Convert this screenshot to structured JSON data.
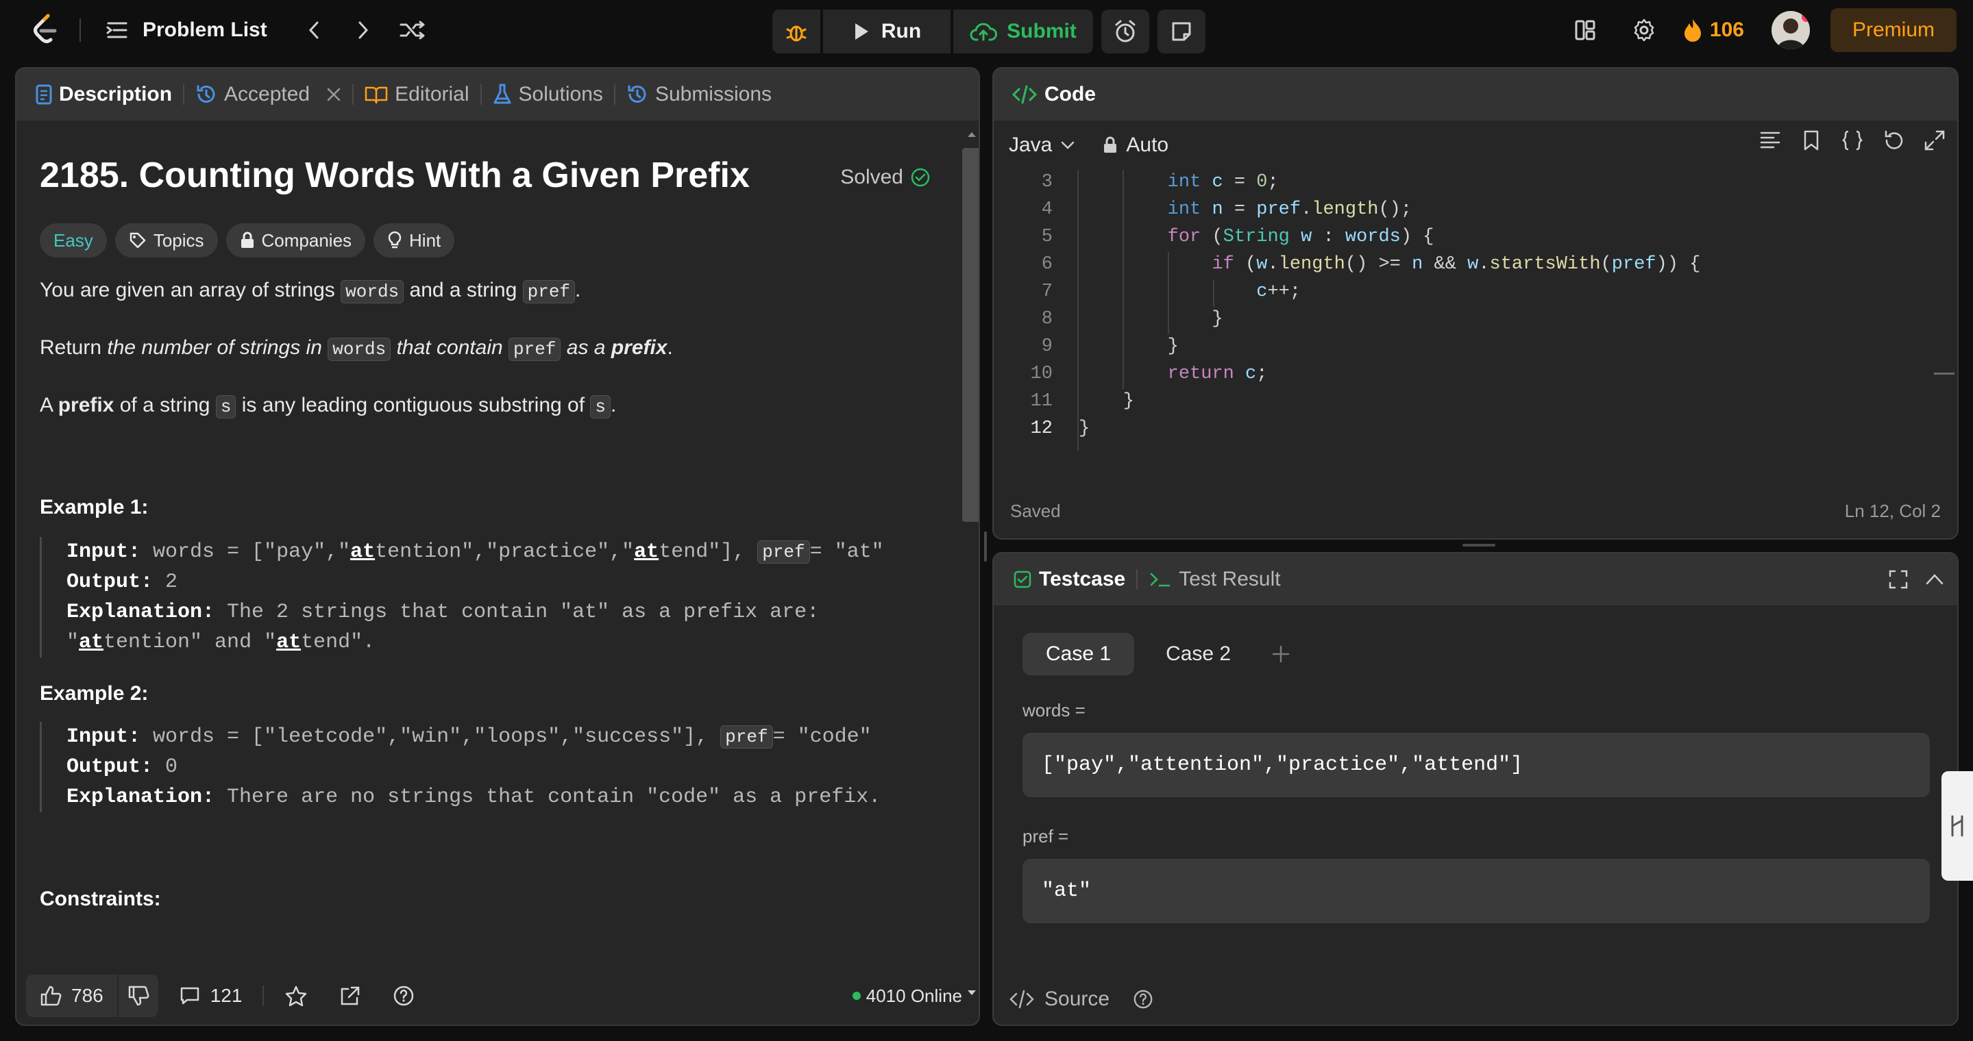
{
  "topbar": {
    "problem_list": "Problem List",
    "run": "Run",
    "submit": "Submit",
    "streak": "106",
    "premium": "Premium"
  },
  "left": {
    "tabs": [
      "Description",
      "Accepted",
      "Editorial",
      "Solutions",
      "Submissions"
    ],
    "title": "2185. Counting Words With a Given Prefix",
    "solved": "Solved",
    "chips": [
      "Easy",
      "Topics",
      "Companies",
      "Hint"
    ],
    "p1": [
      "You are given an array of strings ",
      "words",
      " and a string ",
      "pref",
      "."
    ],
    "p2": [
      "Return ",
      "the number of strings in ",
      "words",
      " that contain ",
      "pref",
      " as a ",
      "prefix",
      "."
    ],
    "p3": [
      "A ",
      "prefix",
      " of a string ",
      "s",
      " is any leading contiguous substring of ",
      "s",
      "."
    ],
    "ex1_title": "Example 1:",
    "ex1": {
      "input_label": "Input:",
      "input_a": " words = [\"pay\",\"",
      "u1": "at",
      "input_b": "tention\",\"practice\",\"",
      "u2": "at",
      "input_c": "tend\"], ",
      "pref": "pref",
      "input_d": "= \"at\"",
      "output_label": "Output:",
      "output": " 2",
      "expl_label": "Explanation:",
      "expl_a": " The 2 strings that contain \"at\" as a prefix are:",
      "expl_b1": "\"",
      "u3": "at",
      "expl_b2": "tention\" and \"",
      "u4": "at",
      "expl_b3": "tend\"."
    },
    "ex2_title": "Example 2:",
    "ex2": {
      "input_label": "Input:",
      "input_a": " words = [\"leetcode\",\"win\",\"loops\",\"success\"], ",
      "pref": "pref",
      "input_b": "= \"code\"",
      "output_label": "Output:",
      "output": " 0",
      "expl_label": "Explanation:",
      "expl": " There are no strings that contain \"code\" as a prefix."
    },
    "constraints": "Constraints:",
    "footer": {
      "likes": "786",
      "comments": "121",
      "online": "4010 Online"
    }
  },
  "code": {
    "header": "Code",
    "lang": "Java",
    "mode": "Auto",
    "lines": [
      {
        "n": "3",
        "t": "        int c = 0;"
      },
      {
        "n": "4",
        "t": "        int n = pref.length();"
      },
      {
        "n": "5",
        "t": "        for (String w : words) {"
      },
      {
        "n": "6",
        "t": "            if (w.length() >= n && w.startsWith(pref)) {"
      },
      {
        "n": "7",
        "t": "                c++;"
      },
      {
        "n": "8",
        "t": "            }"
      },
      {
        "n": "9",
        "t": "        }"
      },
      {
        "n": "10",
        "t": "        return c;"
      },
      {
        "n": "11",
        "t": "    }"
      },
      {
        "n": "12",
        "t": "}"
      }
    ],
    "saved": "Saved",
    "position": "Ln 12, Col 2"
  },
  "test": {
    "tab_testcase": "Testcase",
    "tab_result": "Test Result",
    "cases": [
      "Case 1",
      "Case 2"
    ],
    "words_label": "words =",
    "words_value": "[\"pay\",\"attention\",\"practice\",\"attend\"]",
    "pref_label": "pref =",
    "pref_value": "\"at\"",
    "source": "Source"
  },
  "colors": {
    "accent": "#ffa116",
    "green": "#2cbb5d",
    "easy": "#46c6c2",
    "blue": "#4a90e2"
  }
}
